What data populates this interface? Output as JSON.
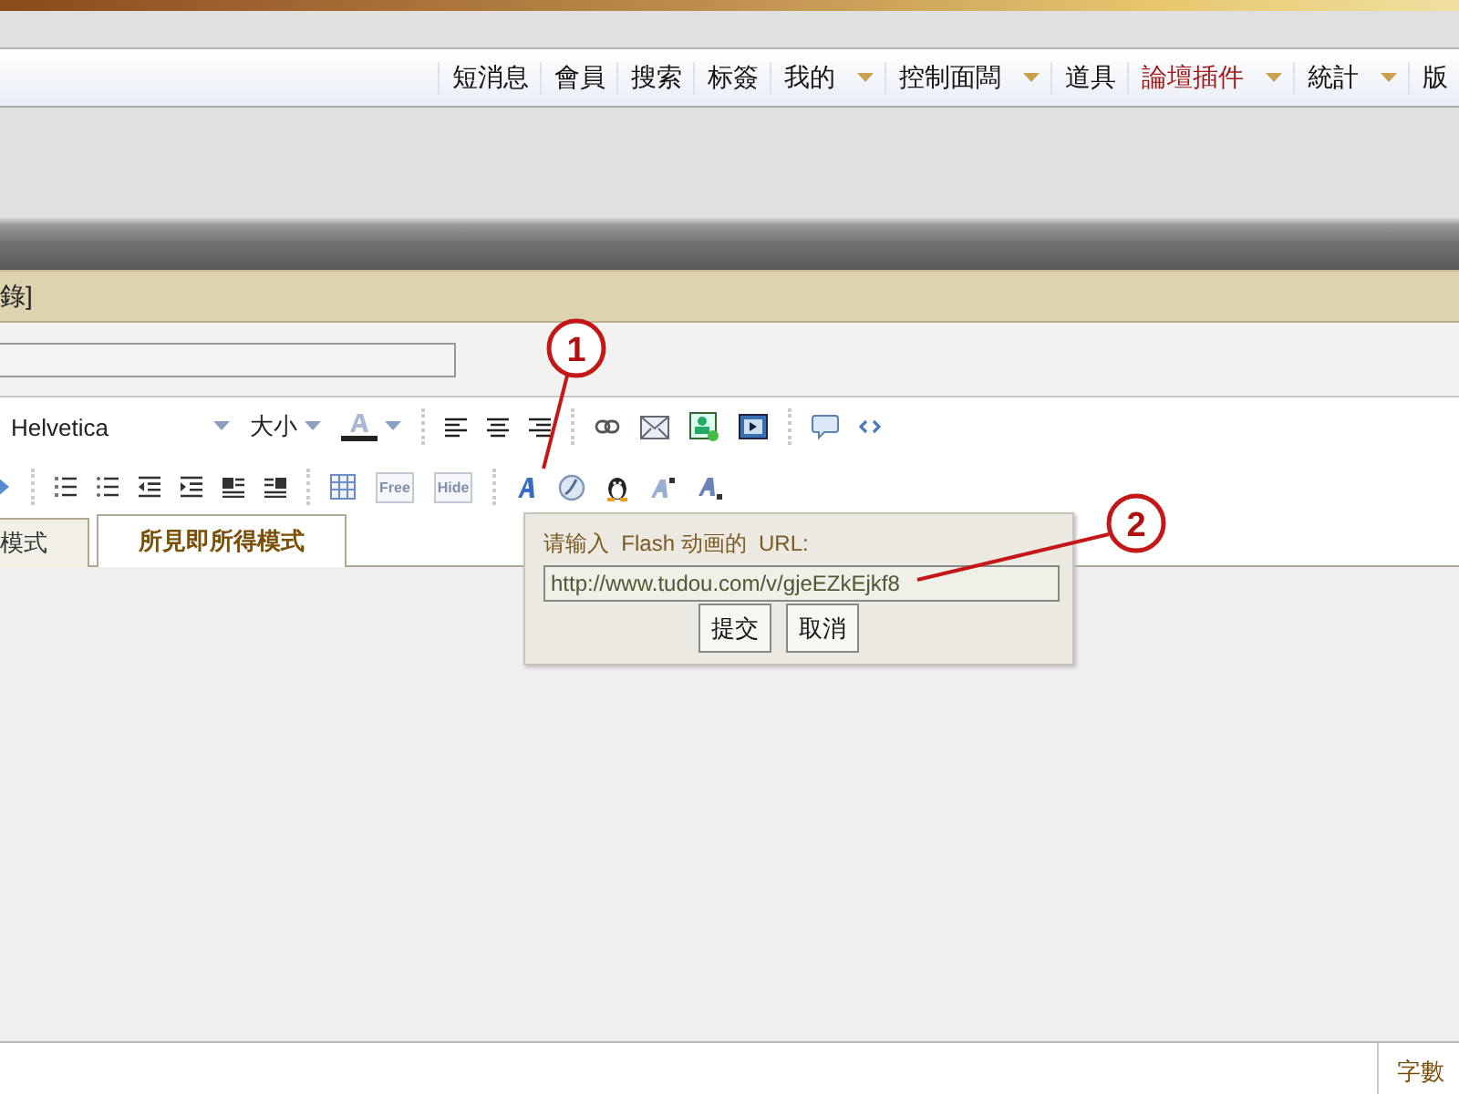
{
  "nav": {
    "items": [
      {
        "label": "短消息",
        "dropdown": false,
        "highlighted": false
      },
      {
        "label": "會員",
        "dropdown": false,
        "highlighted": false
      },
      {
        "label": "搜索",
        "dropdown": false,
        "highlighted": false
      },
      {
        "label": "标簽",
        "dropdown": false,
        "highlighted": false
      },
      {
        "label": "我的",
        "dropdown": true,
        "highlighted": false
      },
      {
        "label": "控制面闆",
        "dropdown": true,
        "highlighted": false
      },
      {
        "label": "道具",
        "dropdown": false,
        "highlighted": false
      },
      {
        "label": "論壇插件",
        "dropdown": true,
        "highlighted": true
      },
      {
        "label": "統計",
        "dropdown": true,
        "highlighted": false
      },
      {
        "label": "版",
        "dropdown": false,
        "highlighted": false
      }
    ]
  },
  "section_title": "錄]",
  "toolbar": {
    "font": "Helvetica",
    "size": "大小",
    "tag_buttons": [
      "Free",
      "Hide"
    ]
  },
  "tabs": [
    {
      "label": "模式",
      "selected": false
    },
    {
      "label": "所見即所得模式",
      "selected": true
    }
  ],
  "popup": {
    "prompt": "请输入  Flash 动画的  URL:",
    "url": "http://www.tudou.com/v/gjeEZkEjkf8",
    "buttons": [
      "提交",
      "取消"
    ]
  },
  "annotations": [
    {
      "number": "1"
    },
    {
      "number": "2"
    }
  ],
  "status_bar": {
    "text": "字數"
  }
}
